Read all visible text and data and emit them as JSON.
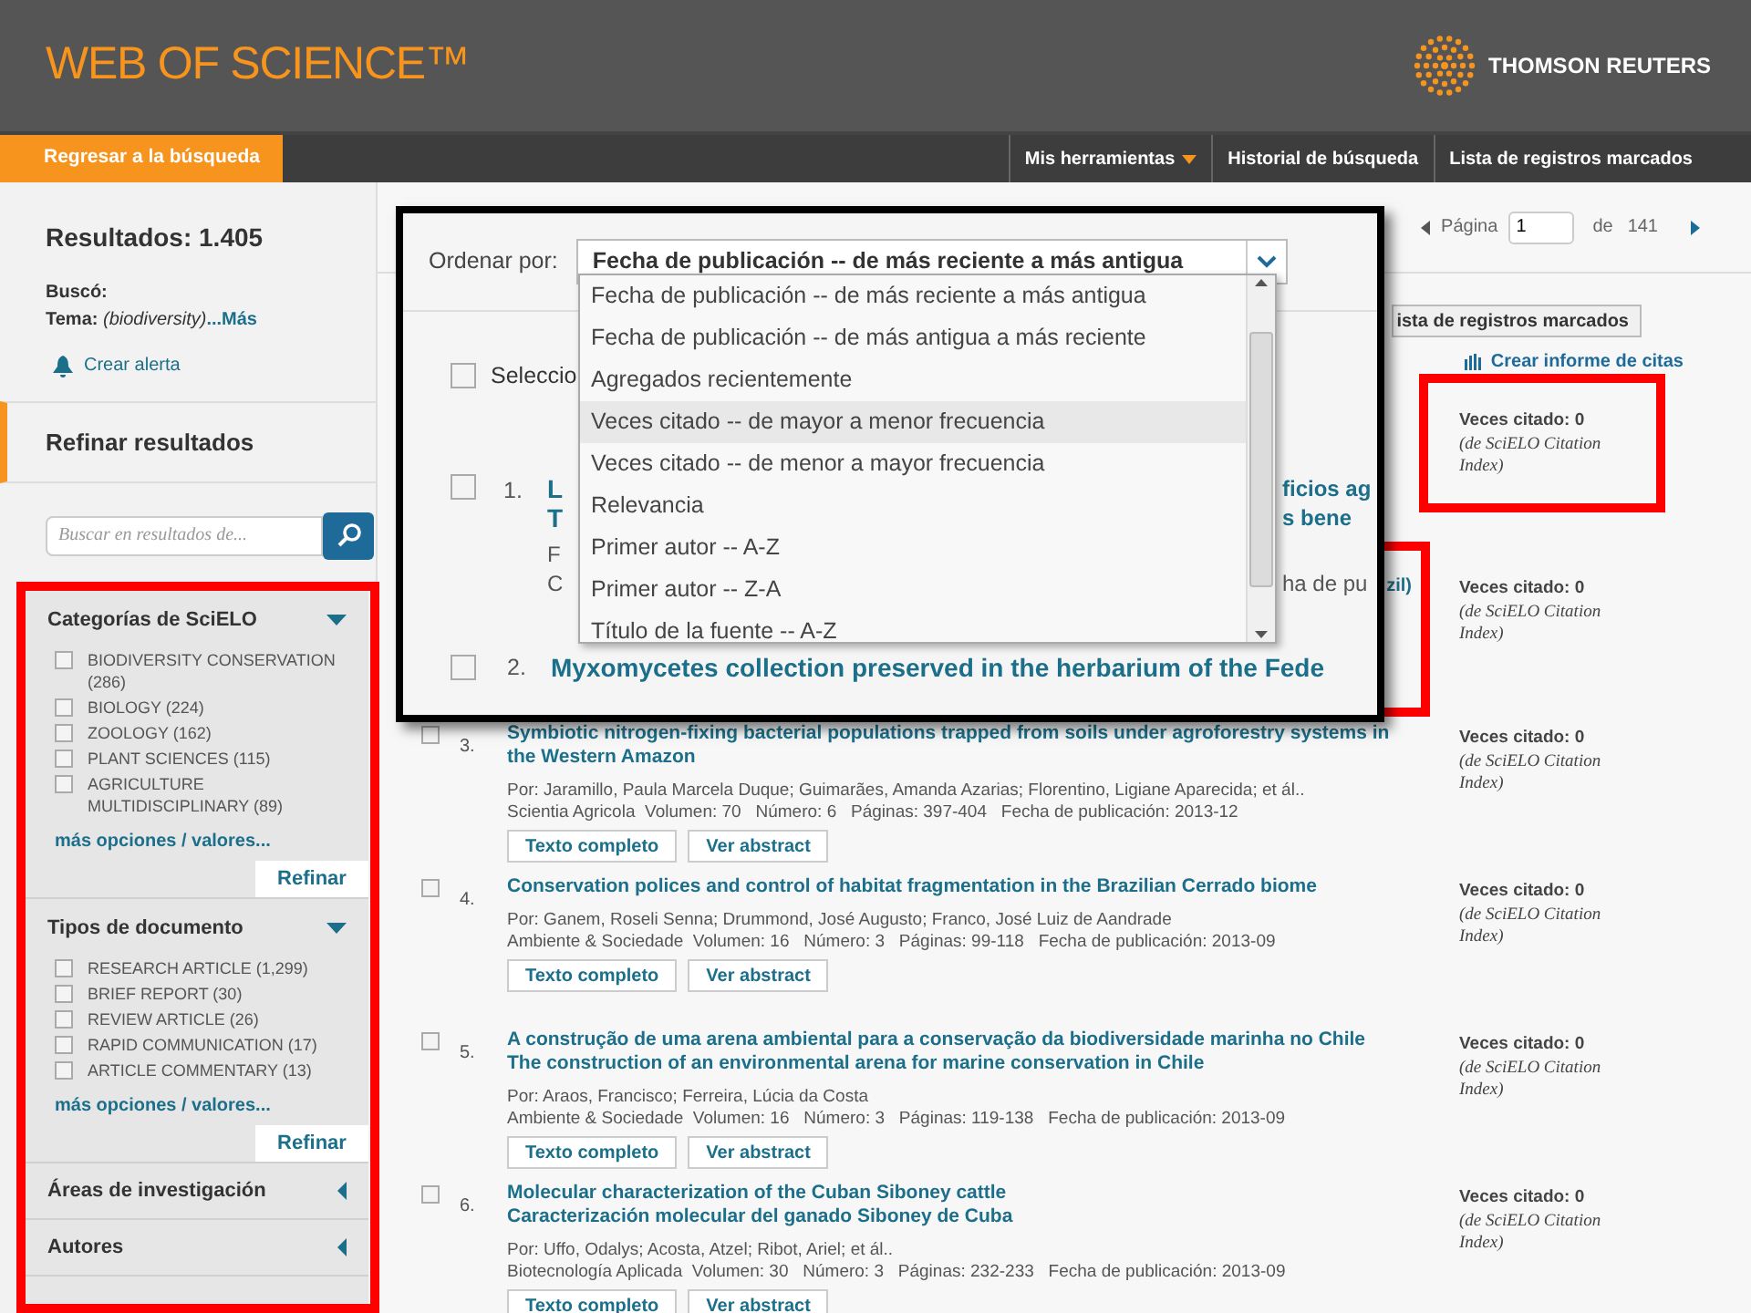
{
  "header": {
    "logo_text": "WEB OF SCIENCE™",
    "brand": "THOMSON REUTERS"
  },
  "nav": {
    "back": "Regresar a la búsqueda",
    "items": [
      {
        "label": "Mis herramientas",
        "dropdown": true
      },
      {
        "label": "Historial de búsqueda",
        "dropdown": false
      },
      {
        "label": "Lista de registros marcados",
        "dropdown": false
      }
    ]
  },
  "sidebar": {
    "results": "Resultados: 1.405",
    "searched_label": "Buscó:",
    "query_label": "Tema:",
    "query": "(biodiversity)",
    "more": "...Más",
    "alert": "Crear alerta",
    "refine_title": "Refinar resultados",
    "search_placeholder": "Buscar en resultados de...",
    "facets": [
      {
        "title": "Categorías de SciELO",
        "expanded": true,
        "more": "más opciones / valores...",
        "button": "Refinar",
        "options": [
          {
            "label": "BIODIVERSITY CONSERVATION (286)",
            "checked": false
          },
          {
            "label": "BIOLOGY (224)",
            "checked": false
          },
          {
            "label": "ZOOLOGY (162)",
            "checked": false
          },
          {
            "label": "PLANT SCIENCES (115)",
            "checked": false
          },
          {
            "label": "AGRICULTURE MULTIDISCIPLINARY (89)",
            "checked": false
          }
        ]
      },
      {
        "title": "Tipos de documento",
        "expanded": true,
        "more": "más opciones / valores...",
        "button": "Refinar",
        "options": [
          {
            "label": "RESEARCH ARTICLE (1,299)",
            "checked": false
          },
          {
            "label": "BRIEF REPORT (30)",
            "checked": false
          },
          {
            "label": "REVIEW ARTICLE (26)",
            "checked": false
          },
          {
            "label": "RAPID COMMUNICATION (17)",
            "checked": false
          },
          {
            "label": "ARTICLE COMMENTARY (13)",
            "checked": false
          }
        ]
      },
      {
        "title": "Áreas de investigación",
        "expanded": false
      },
      {
        "title": "Autores",
        "expanded": false
      }
    ]
  },
  "pagination": {
    "label": "Página",
    "value": "1",
    "of": "de",
    "total": "141"
  },
  "marked_list_button": "ista de registros marcados",
  "citation_report": "Crear informe de citas",
  "results": [
    {
      "times_cited": "Veces citado: 0",
      "cited_note": "(de SciELO Citation Index)"
    },
    {
      "fragment": "zil)",
      "times_cited": "Veces citado: 0",
      "cited_note": "(de SciELO Citation Index)"
    },
    {
      "number": "3.",
      "checked": false,
      "title_lines": [
        "Symbiotic nitrogen-fixing bacterial populations trapped from soils under agroforestry systems in the Western Amazon"
      ],
      "authors": "Por: Jaramillo, Paula Marcela Duque; Guimarães, Amanda Azarias; Florentino, Ligiane Aparecida; et ál..",
      "source": "Scientia Agricola  Volumen: 70   Número: 6   Páginas: 397-404   Fecha de publicación: 2013-12",
      "buttons": [
        "Texto completo",
        "Ver abstract"
      ],
      "times_cited": "Veces citado: 0",
      "cited_note": "(de SciELO Citation Index)"
    },
    {
      "number": "4.",
      "checked": false,
      "title_lines": [
        "Conservation polices and control of habitat fragmentation in the Brazilian Cerrado biome"
      ],
      "authors": "Por: Ganem, Roseli Senna; Drummond, José Augusto; Franco, José Luiz de Aandrade",
      "source": "Ambiente & Sociedade  Volumen: 16   Número: 3   Páginas: 99-118   Fecha de publicación: 2013-09",
      "buttons": [
        "Texto completo",
        "Ver abstract"
      ],
      "times_cited": "Veces citado: 0",
      "cited_note": "(de SciELO Citation Index)"
    },
    {
      "number": "5.",
      "checked": false,
      "title_lines": [
        "A construção de uma arena ambiental para a conservação da biodiversidade marinha no Chile",
        "The construction of an environmental arena for marine conservation in Chile"
      ],
      "authors": "Por: Araos, Francisco; Ferreira, Lúcia da Costa",
      "source": "Ambiente & Sociedade  Volumen: 16   Número: 3   Páginas: 119-138   Fecha de publicación: 2013-09",
      "buttons": [
        "Texto completo",
        "Ver abstract"
      ],
      "times_cited": "Veces citado: 0",
      "cited_note": "(de SciELO Citation Index)"
    },
    {
      "number": "6.",
      "checked": false,
      "title_lines": [
        "Molecular characterization of the Cuban Siboney cattle",
        "Caracterización molecular del ganado Siboney de Cuba"
      ],
      "authors": "Por: Uffo, Odalys; Acosta, Atzel; Ribot, Ariel; et ál..",
      "source": "Biotecnología Aplicada  Volumen: 30   Número: 3   Páginas: 232-233   Fecha de publicación: 2013-09",
      "buttons": [
        "Texto completo",
        "Ver abstract"
      ],
      "times_cited": "Veces citado: 0",
      "cited_note": "(de SciELO Citation Index)"
    }
  ],
  "callout": {
    "sort_label": "Ordenar por:",
    "sort_value": "Fecha de publicación -- de más reciente a más antigua",
    "expanded": true,
    "options": [
      {
        "label": "Fecha de publicación -- de más reciente a más antigua",
        "selected": false
      },
      {
        "label": "Fecha de publicación -- de más antigua a más reciente",
        "selected": false
      },
      {
        "label": "Agregados recientemente",
        "selected": false
      },
      {
        "label": "Veces citado -- de mayor a menor frecuencia",
        "selected": true
      },
      {
        "label": "Veces citado -- de menor a mayor frecuencia",
        "selected": false
      },
      {
        "label": "Relevancia",
        "selected": false
      },
      {
        "label": "Primer autor -- A-Z",
        "selected": false
      },
      {
        "label": "Primer autor -- Z-A",
        "selected": false
      },
      {
        "label": "Título de la fuente -- A-Z",
        "selected": false
      }
    ],
    "select_all": "Seleccio",
    "select_all_checked": false,
    "row_1": {
      "number": "1.",
      "checked": false,
      "title_start": [
        "L",
        "T"
      ],
      "detail_start": [
        "F",
        "C"
      ],
      "title_end": [
        "ficios ag",
        "s bene"
      ],
      "detail_end": "ha de pu"
    },
    "row_2": {
      "number": "2.",
      "checked": false,
      "title": "Myxomycetes collection preserved in the herbarium of the Fede"
    }
  }
}
